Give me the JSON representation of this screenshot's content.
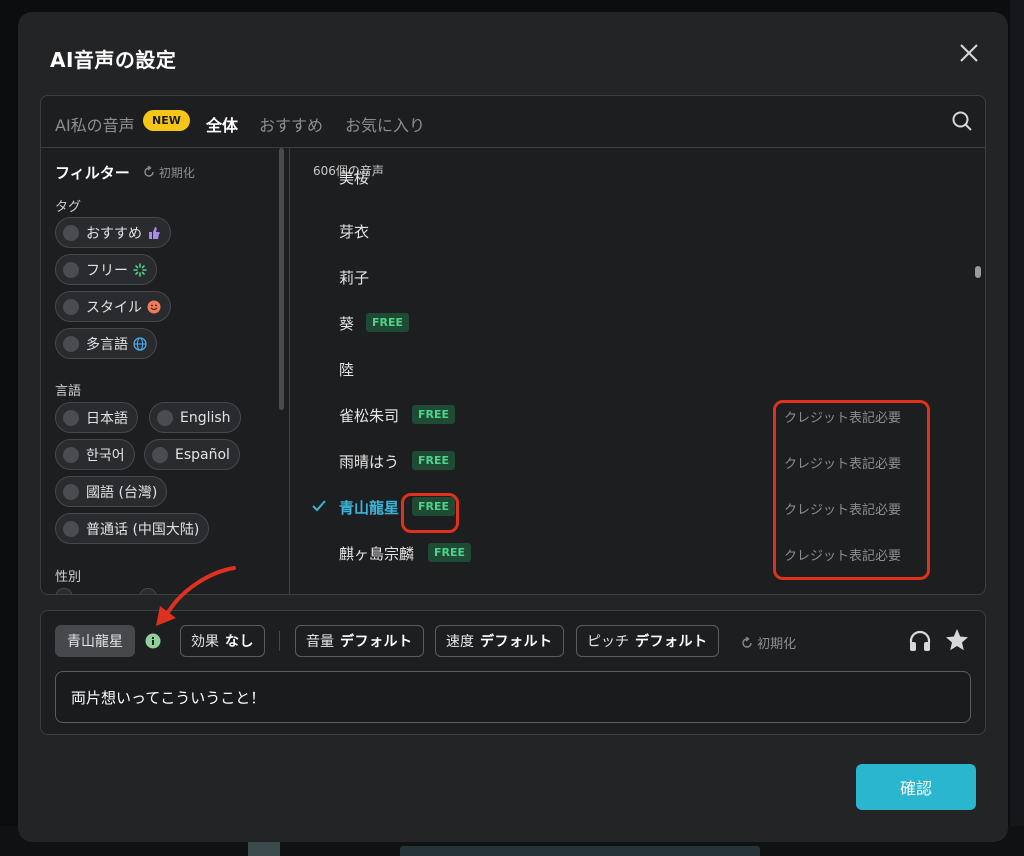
{
  "modal": {
    "title": "AI音声の設定"
  },
  "tabs": [
    {
      "label": "AI私の音声",
      "badge": "NEW"
    },
    {
      "label": "全体"
    },
    {
      "label": "おすすめ"
    },
    {
      "label": "お気に入り"
    }
  ],
  "sidebar": {
    "title": "フィルター",
    "reset": "初期化",
    "tag_label": "タグ",
    "tags": [
      "おすすめ",
      "フリー",
      "スタイル",
      "多言語"
    ],
    "language_label": "言語",
    "languages": [
      "日本語",
      "English",
      "한국어",
      "Español",
      "國語 (台灣)",
      "普通话 (中国大陆)"
    ],
    "gender_label": "性別"
  },
  "voice_list": {
    "count": "606個の音声",
    "free_badge": "FREE",
    "credit_note": "クレジット表記必要",
    "voices": [
      {
        "name": "美桜"
      },
      {
        "name": "芽衣"
      },
      {
        "name": "莉子"
      },
      {
        "name": "葵",
        "free": true
      },
      {
        "name": "陸"
      },
      {
        "name": "雀松朱司",
        "free": true,
        "credit": true
      },
      {
        "name": "雨晴はう",
        "free": true,
        "credit": true
      },
      {
        "name": "青山龍星",
        "free": true,
        "credit": true,
        "selected": true
      },
      {
        "name": "麒ヶ島宗麟",
        "free": true,
        "credit": true
      }
    ]
  },
  "editor": {
    "selected_voice": "青山龍星",
    "effect": {
      "key": "効果",
      "value": "なし"
    },
    "volume": {
      "key": "音量",
      "value": "デフォルト"
    },
    "speed": {
      "key": "速度",
      "value": "デフォルト"
    },
    "pitch": {
      "key": "ピッチ",
      "value": "デフォルト"
    },
    "reset": "初期化",
    "text": "両片想いってこういうこと！"
  },
  "confirm_label": "確認",
  "colors": {
    "accent": "#29b6ce",
    "selected_text": "#3ab4d8",
    "free_badge_bg": "#1f4a33",
    "free_badge_text": "#4fd28b",
    "new_badge": "#f5c518",
    "highlight": "#e0301e"
  }
}
